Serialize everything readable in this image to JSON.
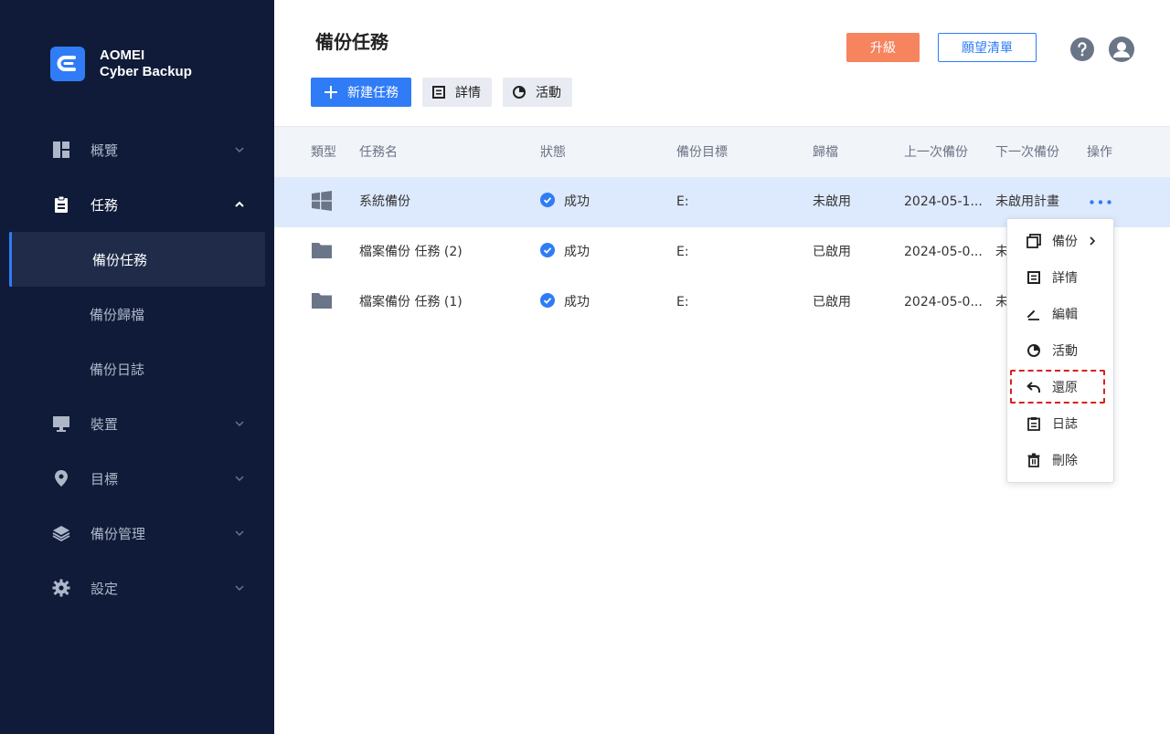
{
  "brand": {
    "line1": "AOMEI",
    "line2": "Cyber Backup",
    "logo_icon": "cyber-backup-logo-icon",
    "accent": "#2f7cf6"
  },
  "sidebar": {
    "items": [
      {
        "label": "概覽",
        "icon": "dashboard-icon"
      },
      {
        "label": "任務",
        "icon": "clipboard-icon",
        "expanded": true,
        "children": [
          {
            "label": "備份任務",
            "active": true
          },
          {
            "label": "備份歸檔"
          },
          {
            "label": "備份日誌"
          }
        ]
      },
      {
        "label": "裝置",
        "icon": "monitor-icon"
      },
      {
        "label": "目標",
        "icon": "location-pin-icon"
      },
      {
        "label": "備份管理",
        "icon": "layers-icon"
      },
      {
        "label": "設定",
        "icon": "gear-icon"
      }
    ],
    "background": "#0f1b38"
  },
  "header": {
    "title": "備份任務",
    "upgrade_label": "升級",
    "wishlist_label": "願望清單",
    "upgrade_color": "#f6845f"
  },
  "toolbar": {
    "new_task": "新建任務",
    "details": "詳情",
    "activity": "活動"
  },
  "table": {
    "columns": [
      "類型",
      "任務名",
      "狀態",
      "備份目標",
      "歸檔",
      "上一次備份",
      "下一次備份",
      "操作"
    ],
    "rows": [
      {
        "type_icon": "windows-icon",
        "name": "系統備份",
        "status": "成功",
        "target": "E:",
        "archive": "未啟用",
        "last": "2024-05-1...",
        "next": "未啟用計畫",
        "selected": true
      },
      {
        "type_icon": "folder-icon",
        "name": "檔案備份 任務 (2)",
        "status": "成功",
        "target": "E:",
        "archive": "已啟用",
        "last": "2024-05-0...",
        "next": "未",
        "selected": false
      },
      {
        "type_icon": "folder-icon",
        "name": "檔案備份 任務 (1)",
        "status": "成功",
        "target": "E:",
        "archive": "已啟用",
        "last": "2024-05-0...",
        "next": "未",
        "selected": false
      }
    ]
  },
  "context_menu": {
    "items": [
      {
        "label": "備份",
        "icon": "copy-icon",
        "submenu": true
      },
      {
        "label": "詳情",
        "icon": "details-icon"
      },
      {
        "label": "編輯",
        "icon": "edit-icon"
      },
      {
        "label": "活動",
        "icon": "pie-chart-icon"
      },
      {
        "label": "還原",
        "icon": "restore-icon",
        "highlighted": true
      },
      {
        "label": "日誌",
        "icon": "log-icon"
      },
      {
        "label": "刪除",
        "icon": "trash-icon"
      }
    ]
  }
}
